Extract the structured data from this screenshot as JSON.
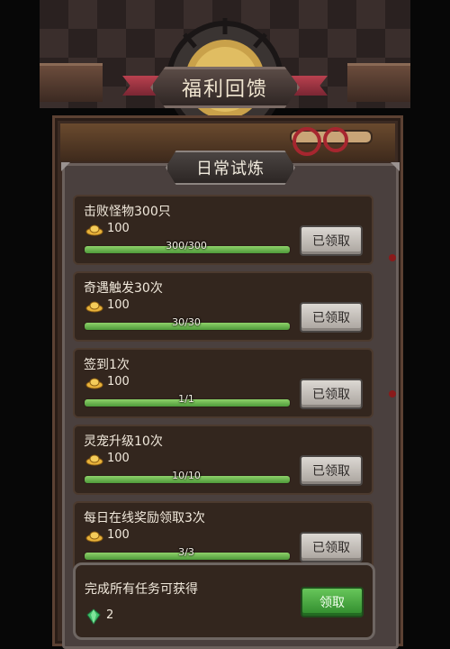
{
  "header": {
    "title": "福利回馈"
  },
  "subtab": {
    "label": "日常试炼"
  },
  "tasks": [
    {
      "name": "击败怪物300只",
      "reward": "100",
      "progress_text": "300/300",
      "progress": 1.0,
      "button": "已领取"
    },
    {
      "name": "奇遇触发30次",
      "reward": "100",
      "progress_text": "30/30",
      "progress": 1.0,
      "button": "已领取"
    },
    {
      "name": "签到1次",
      "reward": "100",
      "progress_text": "1/1",
      "progress": 1.0,
      "button": "已领取"
    },
    {
      "name": "灵宠升级10次",
      "reward": "100",
      "progress_text": "10/10",
      "progress": 1.0,
      "button": "已领取"
    },
    {
      "name": "每日在线奖励领取3次",
      "reward": "100",
      "progress_text": "3/3",
      "progress": 1.0,
      "button": "已领取"
    }
  ],
  "final_reward": {
    "text": "完成所有任务可获得",
    "amount": "2",
    "button": "领取"
  },
  "colors": {
    "progress": "#6cbf4c",
    "claim": "#3fa53a"
  },
  "icons": {
    "reward": "gold-ingot-icon",
    "final": "green-gem-icon"
  }
}
